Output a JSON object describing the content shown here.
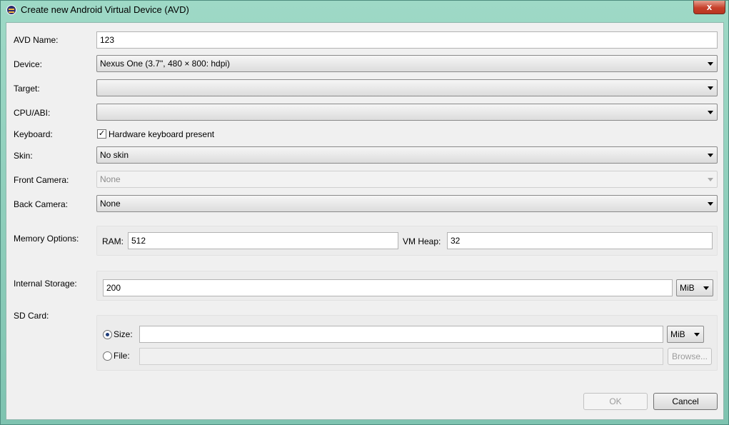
{
  "window": {
    "title": "Create new Android Virtual Device (AVD)",
    "close_glyph": "x"
  },
  "form": {
    "avd_name": {
      "label": "AVD Name:",
      "value": "123"
    },
    "device": {
      "label": "Device:",
      "value": "Nexus One (3.7\", 480 × 800: hdpi)"
    },
    "target": {
      "label": "Target:",
      "value": ""
    },
    "cpu_abi": {
      "label": "CPU/ABI:",
      "value": ""
    },
    "keyboard": {
      "label": "Keyboard:",
      "checkbox_label": "Hardware keyboard present",
      "checked": true,
      "check_glyph": "✓"
    },
    "skin": {
      "label": "Skin:",
      "value": "No skin"
    },
    "front_camera": {
      "label": "Front Camera:",
      "value": "None"
    },
    "back_camera": {
      "label": "Back Camera:",
      "value": "None"
    },
    "memory": {
      "label": "Memory Options:",
      "ram_label": "RAM:",
      "ram_value": "512",
      "vm_heap_label": "VM Heap:",
      "vm_heap_value": "32"
    },
    "internal_storage": {
      "label": "Internal Storage:",
      "value": "200",
      "unit": "MiB"
    },
    "sd_card": {
      "label": "SD Card:",
      "size_label": "Size:",
      "size_value": "",
      "size_unit": "MiB",
      "file_label": "File:",
      "file_value": "",
      "browse_label": "Browse...",
      "selected": "size"
    }
  },
  "buttons": {
    "ok": "OK",
    "cancel": "Cancel"
  }
}
